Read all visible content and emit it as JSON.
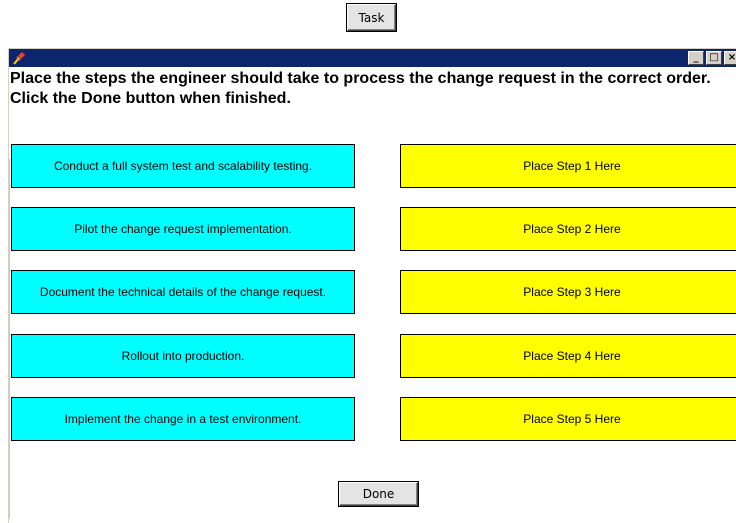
{
  "task_button": {
    "label": "Task"
  },
  "window": {
    "icon": "pin-icon",
    "controls": [
      "minimize-icon",
      "maximize-icon",
      "close-icon"
    ],
    "titlebar_color": "#0c256c"
  },
  "instructions": "Place the steps the engineer should take to process the change request in the correct order. Click the Done button when finished.",
  "steps": [
    "Conduct a full system test and scalability testing.",
    "Pilot the change request implementation.",
    "Document the technical details of the change request.",
    "Rollout into production.",
    "Implement the change in a test environment."
  ],
  "targets": [
    "Place Step 1 Here",
    "Place Step 2 Here",
    "Place Step 3 Here",
    "Place Step 4 Here",
    "Place Step 5 Here"
  ],
  "done_button": {
    "label": "Done"
  },
  "colors": {
    "step_fill": "#00ffff",
    "target_fill": "#ffff00"
  }
}
